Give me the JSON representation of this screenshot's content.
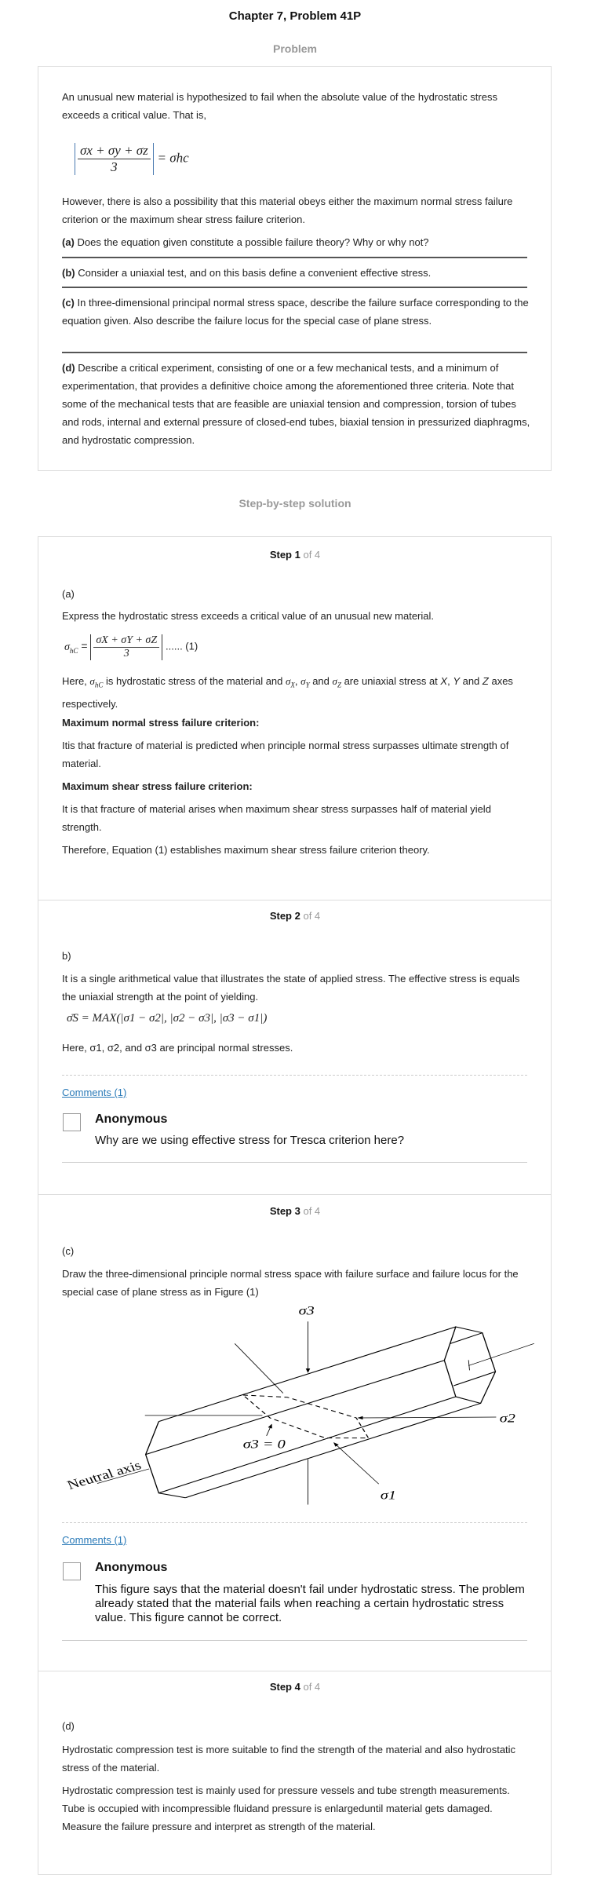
{
  "header": {
    "title": "Chapter 7, Problem 41P",
    "problem_heading": "Problem",
    "solution_heading": "Step-by-step solution"
  },
  "problem": {
    "intro": "An unusual new material is hypothesized to fail when the absolute value of the hydrostatic stress exceeds a critical value. That is,",
    "eq": {
      "num": "σx + σy + σz",
      "den": "3",
      "rhs": "= σhc"
    },
    "however": "However, there is also a possibility that this material obeys either the maximum normal stress failure criterion or the maximum shear stress failure criterion.",
    "parts": [
      {
        "label": "(a)",
        "text": " Does the equation given constitute a possible failure theory? Why or why not?"
      },
      {
        "label": "(b)",
        "text": " Consider a uniaxial test, and on this basis define a convenient effective stress."
      },
      {
        "label": "(c)",
        "text": " In three-dimensional principal normal stress space, describe the failure surface corresponding to the equation given. Also describe the failure locus for the special case of plane stress."
      },
      {
        "label": "(d)",
        "text": " Describe a critical experiment, consisting of one or a few mechanical tests, and a minimum of experimentation, that provides a definitive choice among the aforementioned three criteria. Note that some of the mechanical tests that are feasible are uniaxial tension and compression, torsion of tubes and rods, internal and external pressure of closed-end tubes, biaxial tension in pressurized diaphragms, and hydrostatic compression."
      }
    ]
  },
  "steps": [
    {
      "label": "Step 1",
      "of": "of 4",
      "part": "(a)",
      "p1": "Express the hydrostatic stress exceeds a critical value of an unusual new material.",
      "eq": {
        "lhs": "σ",
        "lhs_sub": "hC",
        "eq": "=",
        "num": "σX + σY + σZ",
        "den": "3",
        "tag": "...... (1)"
      },
      "here": [
        "Here, ",
        "σ",
        "hC",
        " is hydrostatic stress of the material and ",
        "σ",
        "X",
        ", ",
        "σ",
        "Y",
        " and ",
        "σ",
        "Z",
        " are uniaxial stress at ",
        "X",
        ", ",
        "Y",
        " and ",
        "Z",
        " axes respectively."
      ],
      "h1": "Maximum normal stress failure criterion:",
      "p2": "Itis that fracture of material is predicted when principle normal stress surpasses ultimate strength of material.",
      "h2": "Maximum shear stress failure criterion:",
      "p3": "It is that fracture of material arises when maximum shear stress surpasses half of material yield strength.",
      "p4": "Therefore, Equation (1) establishes maximum shear stress failure criterion theory."
    },
    {
      "label": "Step 2",
      "of": "of 4",
      "part": "b)",
      "p1": "It is a single arithmetical value that illustrates the state of applied stress. The effective stress is equals the uniaxial strength at the point of yielding.",
      "eq": "σ̄S = MAX(|σ1 − σ2|, |σ2 − σ3|, |σ3 − σ1|)",
      "here": "Here, σ1, σ2, and σ3 are principal normal stresses.",
      "comments_link": "Comments (1)",
      "comment": {
        "author": "Anonymous",
        "text": "Why are we using effective stress for Tresca criterion here?"
      }
    },
    {
      "label": "Step 3",
      "of": "of 4",
      "part": "(c)",
      "p1": "Draw the three-dimensional principle normal stress space with failure surface and failure locus for the special case of plane stress as in Figure (1)",
      "figure": {
        "sigma3": "σ3",
        "sigma2": "σ2",
        "sigma1": "σ1",
        "sigma3_zero": "σ3 = 0",
        "neutral_axis": "Neutral axis"
      },
      "comments_link": "Comments (1)",
      "comment": {
        "author": "Anonymous",
        "text": "This figure says that the material doesn't fail under hydrostatic stress. The problem already stated that the material fails when reaching a certain hydrostatic stress value. This figure cannot be correct."
      }
    },
    {
      "label": "Step 4",
      "of": "of 4",
      "part": "(d)",
      "p1": "Hydrostatic compression test is more suitable to find the strength of the material and also hydrostatic stress of the material.",
      "p2": "Hydrostatic compression test is mainly used for pressure vessels and tube strength measurements. Tube is occupied with incompressible fluidand pressure is enlargeduntil material gets damaged. Measure the failure pressure and interpret as strength of the material."
    }
  ]
}
